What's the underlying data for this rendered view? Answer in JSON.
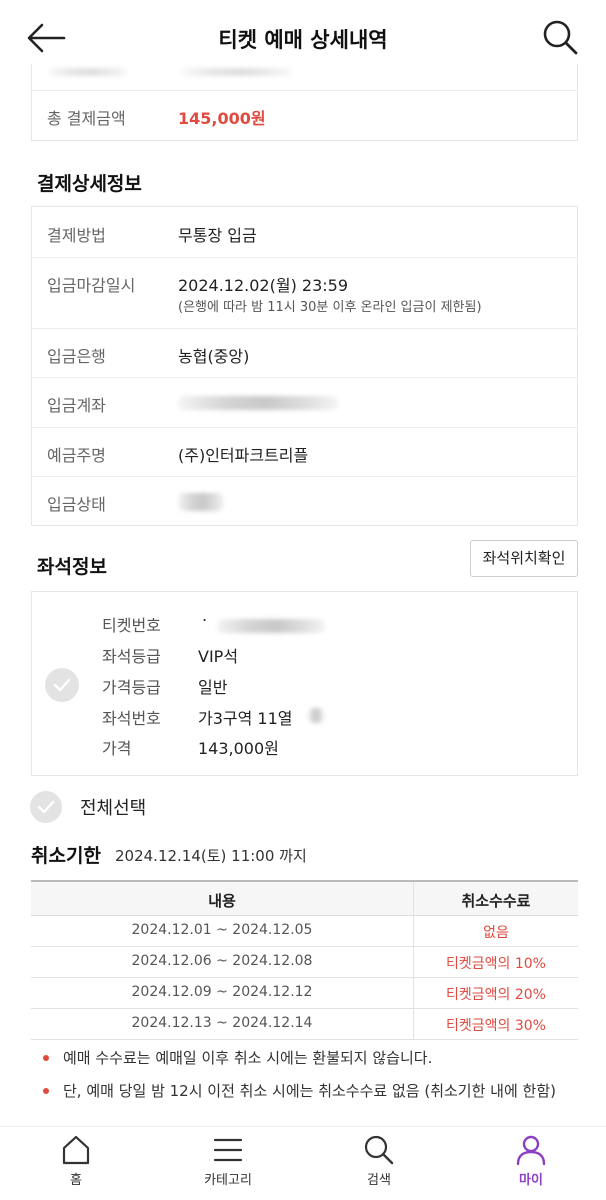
{
  "header": {
    "title": "티켓 예매 상세내역"
  },
  "payment_summary": {
    "total_label": "총 결제금액",
    "total_value": "145,000원"
  },
  "payment_detail": {
    "title": "결제상세정보",
    "method_label": "결제방법",
    "method_value": "무통장 입금",
    "deadline_label": "입금마감일시",
    "deadline_value": "2024.12.02(월) 23:59",
    "deadline_note": "(은행에 따라 밤 11시 30분 이후 온라인 입금이 제한됨)",
    "bank_label": "입금은행",
    "bank_value": "농협(중앙)",
    "account_label": "입금계좌",
    "holder_label": "예금주명",
    "holder_value": "(주)인터파크트리플",
    "status_label": "입금상태"
  },
  "seat_info": {
    "title": "좌석정보",
    "locate_button": "좌석위치확인",
    "ticket_no_label": "티켓번호",
    "grade_label": "좌석등급",
    "grade_value": "VIP석",
    "price_grade_label": "가격등급",
    "price_grade_value": "일반",
    "seat_no_label": "좌석번호",
    "seat_no_value": "가3구역 11열",
    "price_label": "가격",
    "price_value": "143,000원"
  },
  "select_all": "전체선택",
  "cancel": {
    "title": "취소기한",
    "deadline": "2024.12.14(토) 11:00 까지",
    "table_headers": [
      "내용",
      "취소수수료"
    ],
    "rows": [
      {
        "period": "2024.12.01 ~ 2024.12.05",
        "fee": "없음"
      },
      {
        "period": "2024.12.06 ~ 2024.12.08",
        "fee": "티켓금액의 10%"
      },
      {
        "period": "2024.12.09 ~ 2024.12.12",
        "fee": "티켓금액의 20%"
      },
      {
        "period": "2024.12.13 ~ 2024.12.14",
        "fee": "티켓금액의 30%"
      }
    ],
    "notes": [
      "예매 수수료는 예매일 이후 취소 시에는 환불되지 않습니다.",
      "단, 예매 당일 밤 12시 이전 취소 시에는 취소수수료 없음 (취소기한 내에 한함)"
    ]
  },
  "nav": {
    "home": "홈",
    "category": "카테고리",
    "search": "검색",
    "my": "마이"
  },
  "colors": {
    "accent_red": "#e04a3f",
    "nav_active": "#8a3fc4"
  },
  "icons": [
    "back-arrow-icon",
    "search-icon",
    "check-icon",
    "home-icon",
    "menu-icon",
    "person-icon"
  ]
}
